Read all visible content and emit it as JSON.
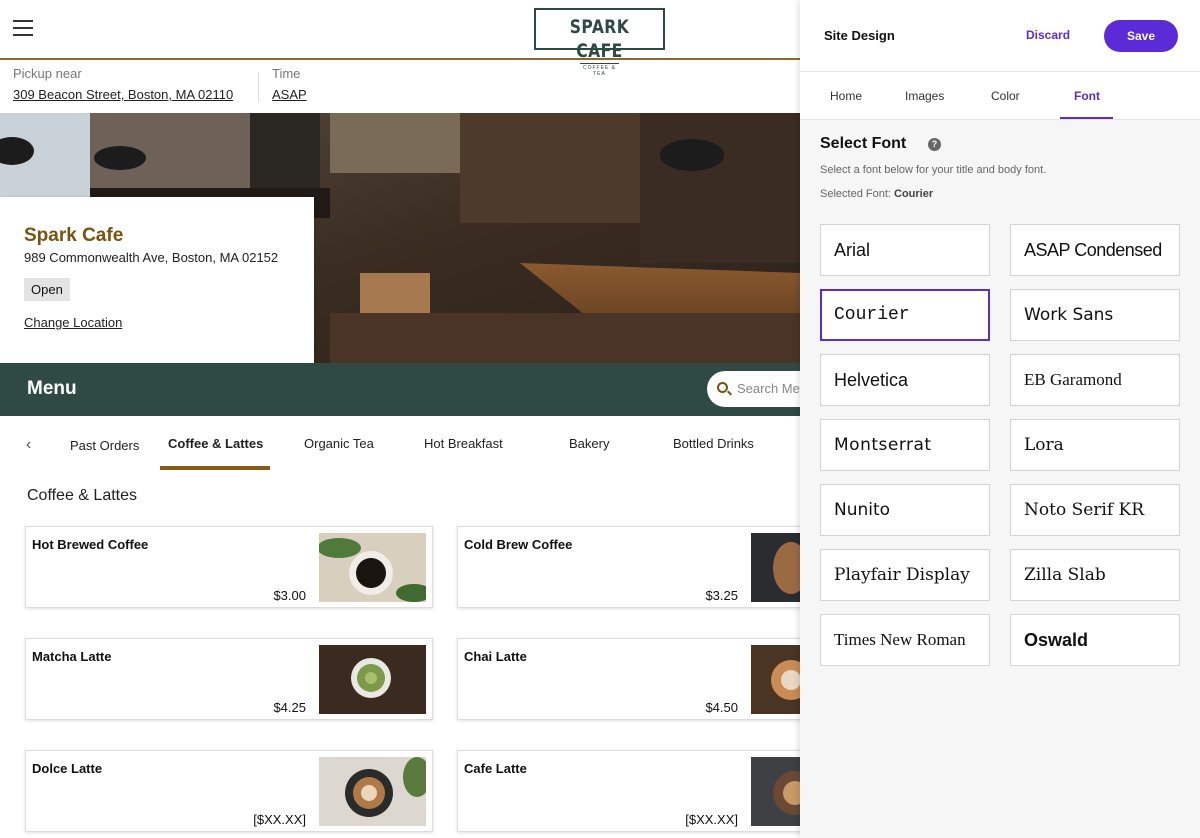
{
  "site": {
    "logo": {
      "name": "SPARK CAFE",
      "tagline": "COFFEE & TEA"
    },
    "pickup": {
      "label": "Pickup near",
      "address": "309 Beacon Street, Boston, MA 02110"
    },
    "time": {
      "label": "Time",
      "value": "ASAP"
    },
    "store": {
      "name": "Spark Cafe",
      "address": "989 Commonwealth Ave, Boston, MA 02152",
      "status": "Open",
      "change_location": "Change Location"
    },
    "menu": {
      "title": "Menu",
      "search_placeholder": "Search Menu"
    },
    "categories": [
      {
        "label": "Past Orders"
      },
      {
        "label": "Coffee & Lattes"
      },
      {
        "label": "Organic Tea"
      },
      {
        "label": "Hot Breakfast"
      },
      {
        "label": "Bakery"
      },
      {
        "label": "Bottled Drinks"
      }
    ],
    "active_category": "Coffee & Lattes",
    "section_title": "Coffee & Lattes",
    "items": [
      {
        "name": "Hot Brewed Coffee",
        "price": "$3.00"
      },
      {
        "name": "Cold Brew Coffee",
        "price": "$3.25"
      },
      {
        "name": "Matcha Latte",
        "price": "$4.25"
      },
      {
        "name": "Chai Latte",
        "price": "$4.50"
      },
      {
        "name": "Dolce Latte",
        "price": "[$XX.XX]"
      },
      {
        "name": "Cafe Latte",
        "price": "[$XX.XX]"
      }
    ]
  },
  "panel": {
    "title": "Site Design",
    "discard": "Discard",
    "save": "Save",
    "tabs": [
      {
        "label": "Home"
      },
      {
        "label": "Images"
      },
      {
        "label": "Color"
      },
      {
        "label": "Font"
      }
    ],
    "active_tab": "Font",
    "select_font": {
      "title": "Select Font",
      "description": "Select a font below for your title and body font.",
      "selected_label": "Selected Font:",
      "selected_value": "Courier"
    },
    "fonts": [
      {
        "name": "Arial"
      },
      {
        "name": "ASAP Condensed"
      },
      {
        "name": "Courier"
      },
      {
        "name": "Work Sans"
      },
      {
        "name": "Helvetica"
      },
      {
        "name": "EB Garamond"
      },
      {
        "name": "Montserrat"
      },
      {
        "name": "Lora"
      },
      {
        "name": "Nunito"
      },
      {
        "name": "Noto Serif KR"
      },
      {
        "name": "Playfair Display"
      },
      {
        "name": "Zilla Slab"
      },
      {
        "name": "Times New Roman"
      },
      {
        "name": "Oswald"
      }
    ]
  },
  "colors": {
    "brand_dark": "#2f4a44",
    "brand_brown": "#7a5210",
    "accent_purple": "#5a2bd6"
  }
}
